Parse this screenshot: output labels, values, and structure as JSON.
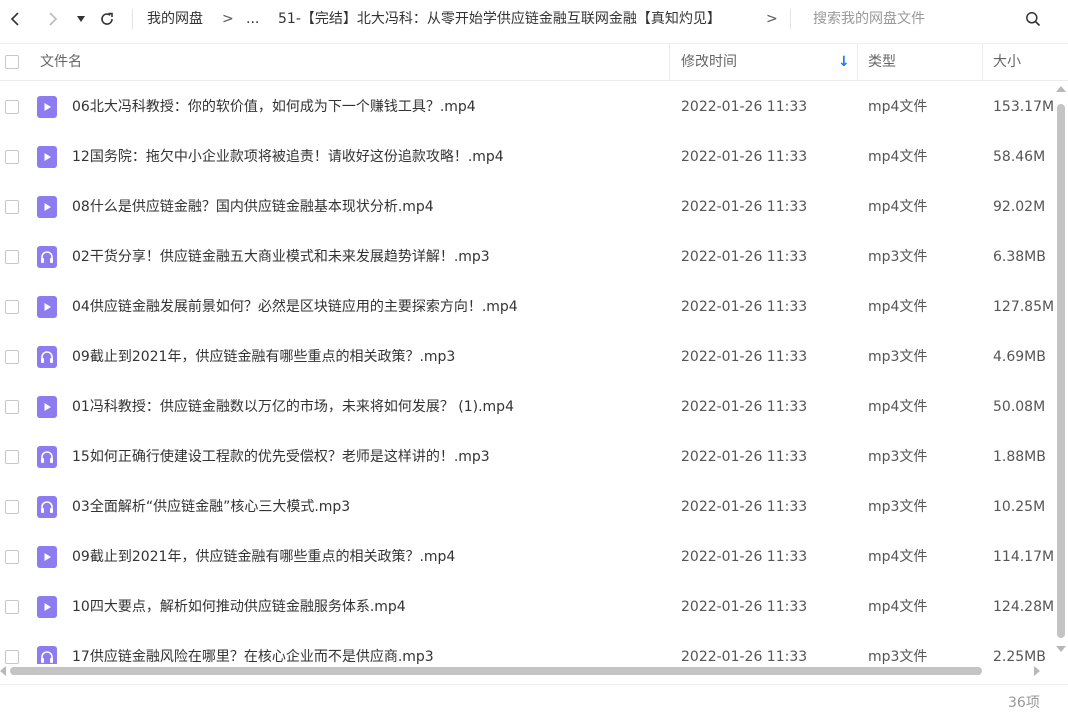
{
  "toolbar": {
    "icons": [
      "back-icon",
      "forward-icon",
      "dropdown-icon",
      "refresh-icon",
      "search-icon"
    ],
    "breadcrumb": {
      "root": "我的网盘",
      "sep1": ">",
      "ellipsis": "...",
      "current": "51-【完结】北大冯科：从零开始学供应链金融互联网金融【真知灼见】",
      "sep2": ">"
    },
    "search_placeholder": "搜索我的网盘文件"
  },
  "columns": {
    "name": "文件名",
    "modified": "修改时间",
    "type": "类型",
    "size": "大小",
    "sort_indicator": "↓"
  },
  "files": [
    {
      "icon": "video-file-icon",
      "name": "06北大冯科教授：你的软价值，如何成为下一个赚钱工具？.mp4",
      "modified": "2022-01-26 11:33",
      "type": "mp4文件",
      "size": "153.17M"
    },
    {
      "icon": "video-file-icon",
      "name": "12国务院：拖欠中小企业款项将被追责！请收好这份追款攻略！.mp4",
      "modified": "2022-01-26 11:33",
      "type": "mp4文件",
      "size": "58.46M"
    },
    {
      "icon": "video-file-icon",
      "name": "08什么是供应链金融？国内供应链金融基本现状分析.mp4",
      "modified": "2022-01-26 11:33",
      "type": "mp4文件",
      "size": "92.02M"
    },
    {
      "icon": "audio-file-icon",
      "name": "02干货分享！供应链金融五大商业模式和未来发展趋势详解！.mp3",
      "modified": "2022-01-26 11:33",
      "type": "mp3文件",
      "size": "6.38MB"
    },
    {
      "icon": "video-file-icon",
      "name": "04供应链金融发展前景如何？必然是区块链应用的主要探索方向！.mp4",
      "modified": "2022-01-26 11:33",
      "type": "mp4文件",
      "size": "127.85M"
    },
    {
      "icon": "audio-file-icon",
      "name": "09截止到2021年，供应链金融有哪些重点的相关政策？.mp3",
      "modified": "2022-01-26 11:33",
      "type": "mp3文件",
      "size": "4.69MB"
    },
    {
      "icon": "video-file-icon",
      "name": "01冯科教授：供应链金融数以万亿的市场，未来将如何发展？ (1).mp4",
      "modified": "2022-01-26 11:33",
      "type": "mp4文件",
      "size": "50.08M"
    },
    {
      "icon": "audio-file-icon",
      "name": "15如何正确行使建设工程款的优先受偿权？老师是这样讲的！.mp3",
      "modified": "2022-01-26 11:33",
      "type": "mp3文件",
      "size": "1.88MB"
    },
    {
      "icon": "audio-file-icon",
      "name": "03全面解析“供应链金融”核心三大模式.mp3",
      "modified": "2022-01-26 11:33",
      "type": "mp3文件",
      "size": "10.25M"
    },
    {
      "icon": "video-file-icon",
      "name": "09截止到2021年，供应链金融有哪些重点的相关政策？.mp4",
      "modified": "2022-01-26 11:33",
      "type": "mp4文件",
      "size": "114.17M"
    },
    {
      "icon": "video-file-icon",
      "name": "10四大要点，解析如何推动供应链金融服务体系.mp4",
      "modified": "2022-01-26 11:33",
      "type": "mp4文件",
      "size": "124.28M"
    },
    {
      "icon": "audio-file-icon",
      "name": "17供应链金融风险在哪里？在核心企业而不是供应商.mp3",
      "modified": "2022-01-26 11:33",
      "type": "mp3文件",
      "size": "2.25MB"
    }
  ],
  "footer": {
    "item_count": "36项"
  },
  "colors": {
    "file_icon": "#8c7cf0",
    "sort_arrow": "#1677ff"
  }
}
